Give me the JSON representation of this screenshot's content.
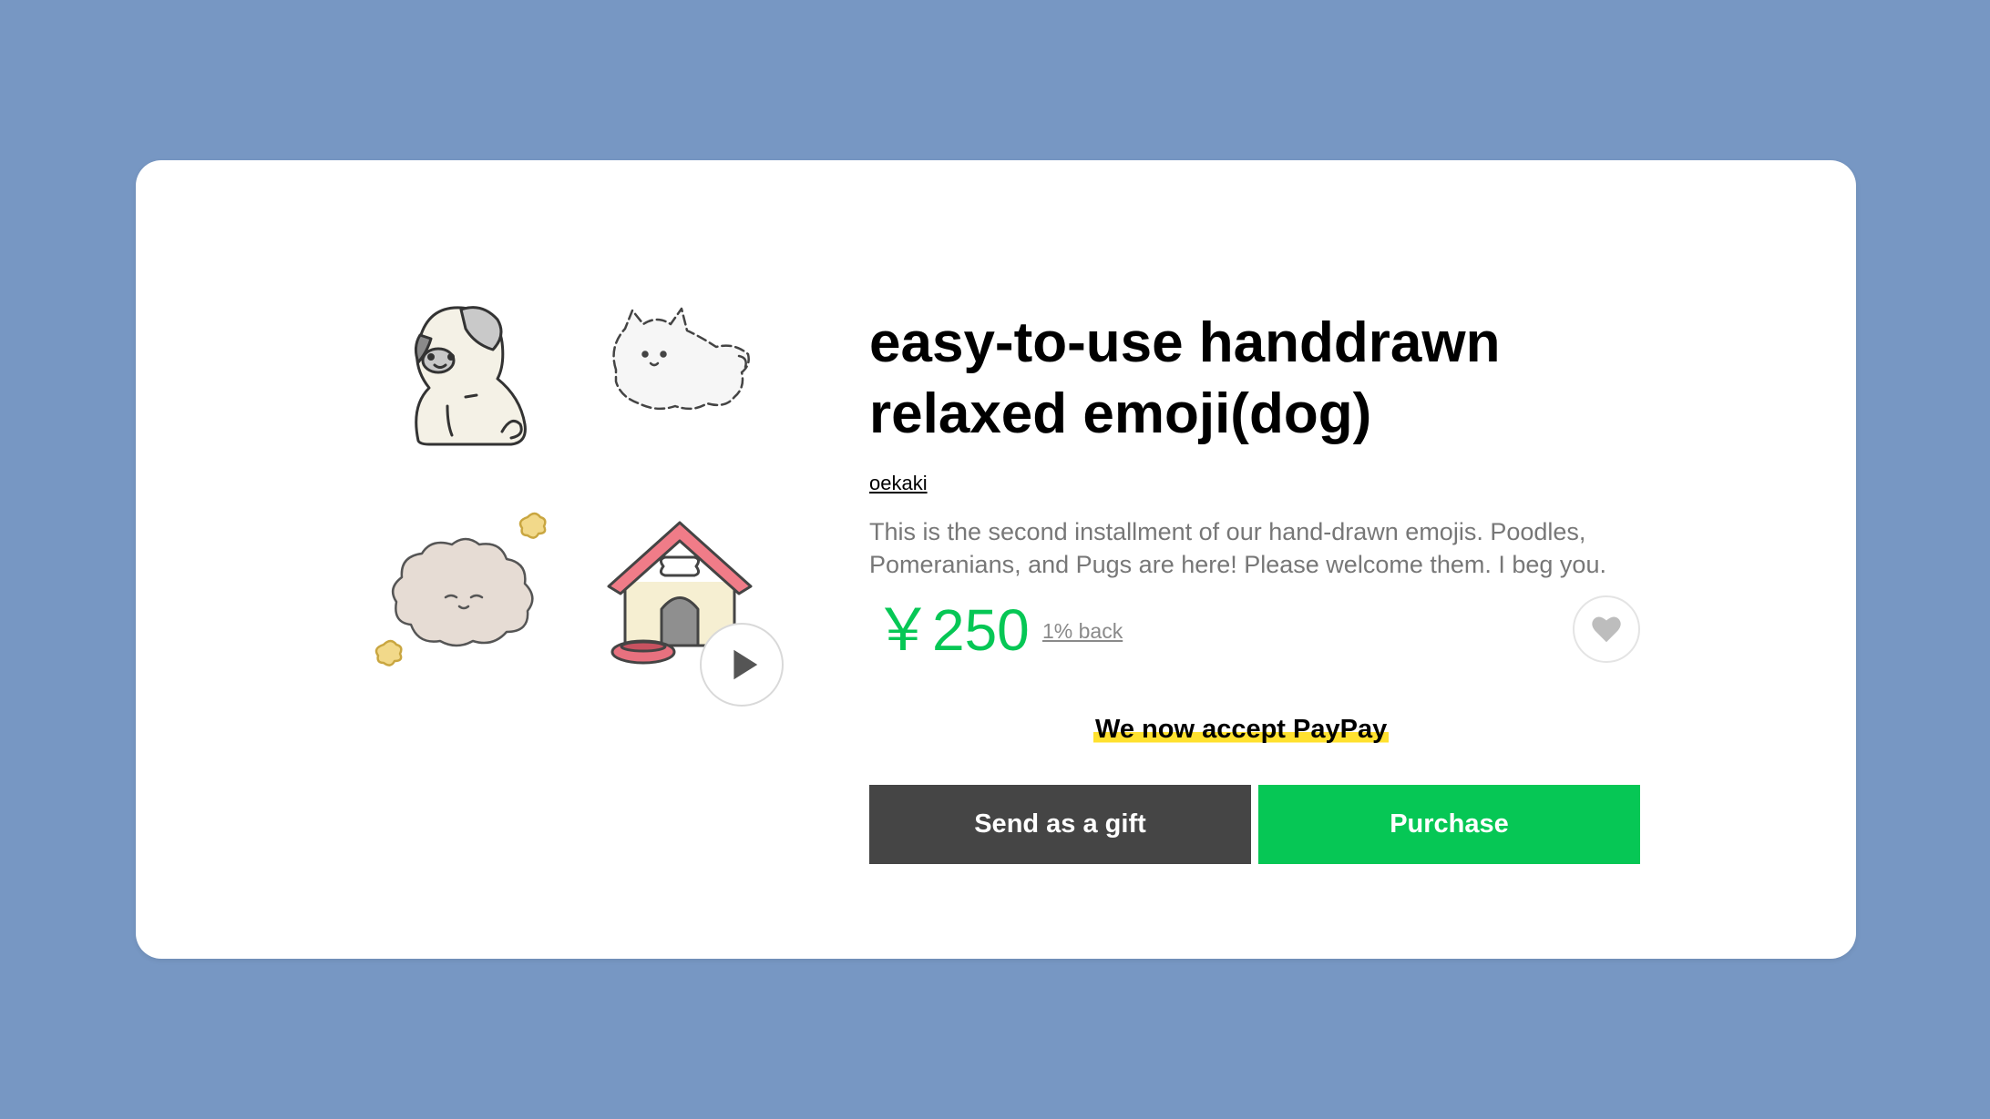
{
  "product": {
    "title": "easy-to-use handdrawn relaxed emoji(dog)",
    "author": "oekaki",
    "description": "This is the second installment of our hand-drawn emojis. Poodles, Pomeranians, and Pugs are here! Please welcome them. I beg you.",
    "price": "￥250",
    "cashback": "1% back"
  },
  "stickers": [
    {
      "name": "pug",
      "icon": "pug-sticker"
    },
    {
      "name": "pomeranian",
      "icon": "pomeranian-sticker"
    },
    {
      "name": "poodle",
      "icon": "poodle-sticker"
    },
    {
      "name": "doghouse",
      "icon": "doghouse-sticker"
    }
  ],
  "icons": {
    "preview": "play-icon",
    "favorite": "heart-icon"
  },
  "notice": {
    "paypay": "We now accept PayPay"
  },
  "actions": {
    "gift_label": "Send as a gift",
    "purchase_label": "Purchase"
  },
  "colors": {
    "background": "#7797c3",
    "card": "#ffffff",
    "accent_green": "#06c755",
    "gift_button": "#454545",
    "highlight_yellow": "#ffe12f"
  }
}
